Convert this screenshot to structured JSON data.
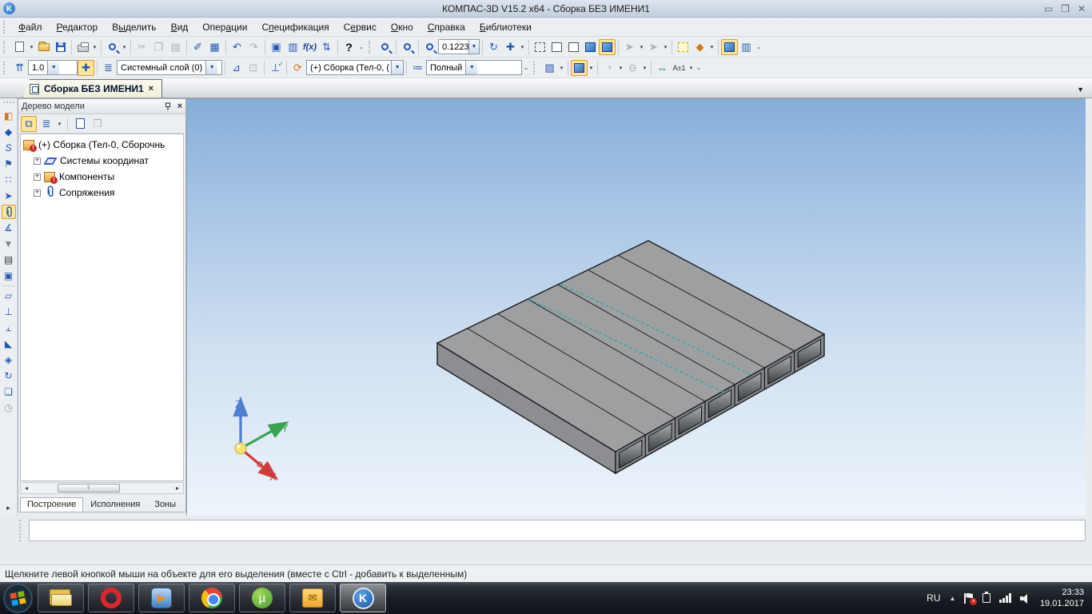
{
  "window": {
    "title": "КОМПАС-3D V15.2  x64 - Сборка БЕЗ ИМЕНИ1"
  },
  "menu": {
    "items": [
      {
        "pre": "",
        "u": "Ф",
        "post": "айл"
      },
      {
        "pre": "",
        "u": "Р",
        "post": "едактор"
      },
      {
        "pre": "В",
        "u": "ы",
        "post": "делить"
      },
      {
        "pre": "",
        "u": "В",
        "post": "ид"
      },
      {
        "pre": "Опер",
        "u": "а",
        "post": "ции"
      },
      {
        "pre": "С",
        "u": "п",
        "post": "ецификация"
      },
      {
        "pre": "С",
        "u": "е",
        "post": "рвис"
      },
      {
        "pre": "",
        "u": "О",
        "post": "кно"
      },
      {
        "pre": "",
        "u": "С",
        "post": "правка"
      },
      {
        "pre": "",
        "u": "Б",
        "post": "иблиотеки"
      }
    ]
  },
  "toolbars": {
    "zoom_scale": "0.1223",
    "fx_label": "f(x)",
    "whatis_label": "?",
    "step_value": "1.0",
    "layer_value": "Системный слой (0)",
    "part_value": "(+) Сборка (Тел-0, (",
    "detail_value": "Полный",
    "tolerance_label": "А±1"
  },
  "doc_tabs": {
    "active_label": "Сборка БЕЗ ИМЕНИ1",
    "close_glyph": "×"
  },
  "model_tree": {
    "title": "Дерево модели",
    "close_glyph": "×",
    "items": [
      {
        "label": "(+) Сборка (Тел-0, Сборочнь"
      },
      {
        "label": "Системы координат"
      },
      {
        "label": "Компоненты"
      },
      {
        "label": "Сопряжения"
      }
    ],
    "tabs": [
      {
        "label": "Построение"
      },
      {
        "label": "Исполнения"
      },
      {
        "label": "Зоны"
      }
    ]
  },
  "viewport": {
    "axes": {
      "x": "X",
      "y": "Y",
      "z": "Z"
    }
  },
  "status": {
    "message": "Щелкните левой кнопкой мыши на объекте для его выделения (вместе с Ctrl - добавить к выделенным)"
  },
  "taskbar": {
    "tray": {
      "lang": "RU",
      "time": "23:33",
      "date": "19.01.2017"
    }
  },
  "colors": {
    "highlight": "#fde69c",
    "viewport_top": "#86aed9",
    "viewport_bottom": "#eef4fb",
    "model_gray": "#9e9fa1",
    "hidden_line": "#2ba8a8"
  }
}
